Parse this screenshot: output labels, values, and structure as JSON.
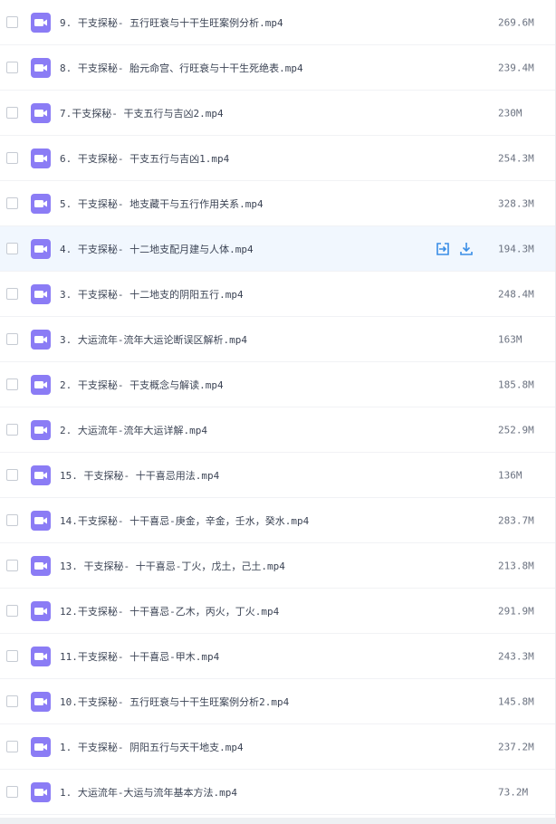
{
  "colors": {
    "icon_bg": "#8b7cf5",
    "action": "#3a8ee6",
    "hover_row": "#f1f7fe"
  },
  "files": [
    {
      "name": "9. 干支探秘- 五行旺衰与十干生旺案例分析.mp4",
      "size": "269.6M"
    },
    {
      "name": "8. 干支探秘- 胎元命宫、行旺衰与十干生死绝表.mp4",
      "size": "239.4M"
    },
    {
      "name": "7.干支探秘- 干支五行与吉凶2.mp4",
      "size": "230M"
    },
    {
      "name": "6. 干支探秘- 干支五行与吉凶1.mp4",
      "size": "254.3M"
    },
    {
      "name": "5. 干支探秘- 地支藏干与五行作用关系.mp4",
      "size": "328.3M"
    },
    {
      "name": "4. 干支探秘- 十二地支配月建与人体.mp4",
      "size": "194.3M",
      "hovered": true
    },
    {
      "name": "3. 干支探秘- 十二地支的阴阳五行.mp4",
      "size": "248.4M"
    },
    {
      "name": "3. 大运流年-流年大运论断误区解析.mp4",
      "size": "163M"
    },
    {
      "name": "2. 干支探秘- 干支概念与解读.mp4",
      "size": "185.8M"
    },
    {
      "name": "2. 大运流年-流年大运详解.mp4",
      "size": "252.9M"
    },
    {
      "name": "15. 干支探秘- 十干喜忌用法.mp4",
      "size": "136M"
    },
    {
      "name": "14.干支探秘- 十干喜忌-庚金，辛金，壬水，癸水.mp4",
      "size": "283.7M"
    },
    {
      "name": "13. 干支探秘- 十干喜忌-丁火，戊土，己土.mp4",
      "size": "213.8M"
    },
    {
      "name": "12.干支探秘- 十干喜忌-乙木，丙火，丁火.mp4",
      "size": "291.9M"
    },
    {
      "name": "11.干支探秘- 十干喜忌-甲木.mp4",
      "size": "243.3M"
    },
    {
      "name": "10.干支探秘- 五行旺衰与十干生旺案例分析2.mp4",
      "size": "145.8M"
    },
    {
      "name": "1. 干支探秘- 阴阳五行与天干地支.mp4",
      "size": "237.2M"
    },
    {
      "name": "1. 大运流年-大运与流年基本方法.mp4",
      "size": "73.2M"
    }
  ]
}
